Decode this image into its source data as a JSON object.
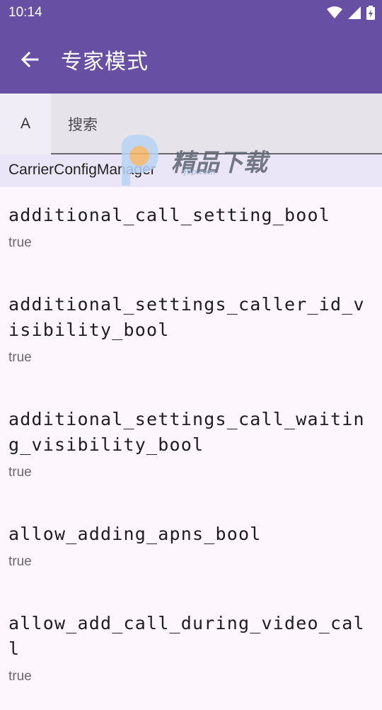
{
  "status_bar": {
    "time": "10:14",
    "icons": [
      "wifi-icon",
      "cellular-signal-icon",
      "battery-charging-icon"
    ]
  },
  "app_bar": {
    "title": "专家模式",
    "back_icon": "arrow-left-icon"
  },
  "search": {
    "prefix": "A",
    "placeholder": "搜索"
  },
  "section": {
    "title": "CarrierConfigManager"
  },
  "items": [
    {
      "key": "additional_call_setting_bool",
      "value": "true"
    },
    {
      "key": "additional_settings_caller_id_visibility_bool",
      "value": "true"
    },
    {
      "key": "additional_settings_call_waiting_visibility_bool",
      "value": "true"
    },
    {
      "key": "allow_adding_apns_bool",
      "value": "true"
    },
    {
      "key": "allow_add_call_during_video_call",
      "value": "true"
    }
  ],
  "watermark": {
    "text": "精品下载",
    "sub": "rj9p.com"
  },
  "colors": {
    "primary": "#6750a4",
    "background": "#fdf6fd",
    "section_bg": "#ebe6f7",
    "search_bg": "#e7e3ea"
  }
}
